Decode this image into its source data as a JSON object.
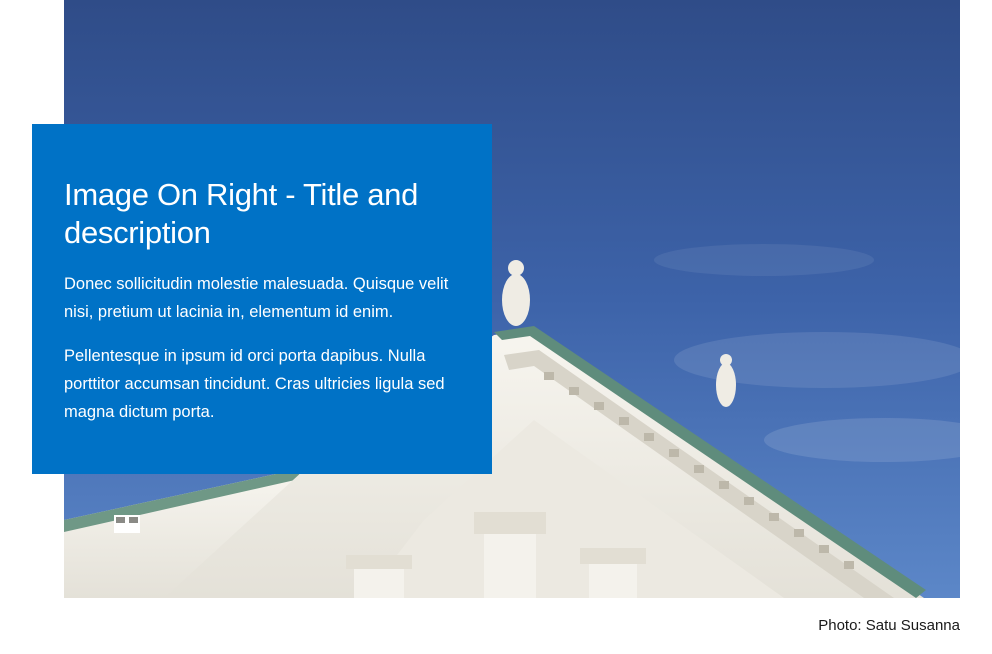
{
  "hero": {
    "title": "Image On Right - Title and description",
    "paragraphs": [
      "Donec sollicitudin molestie malesuada. Quisque velit nisi, pretium ut lacinia in, elementum id enim.",
      "Pellentesque in ipsum id orci porta dapibus. Nulla porttitor accumsan tincidunt. Cras ultricies ligula sed magna dictum porta."
    ],
    "caption": "Photo: Satu Susanna"
  },
  "colors": {
    "card_background": "#0072c6",
    "card_text": "#ffffff",
    "sky": "#3a5ea4",
    "building": "#f1efe8",
    "roof_trim": "#5f8c7c"
  }
}
